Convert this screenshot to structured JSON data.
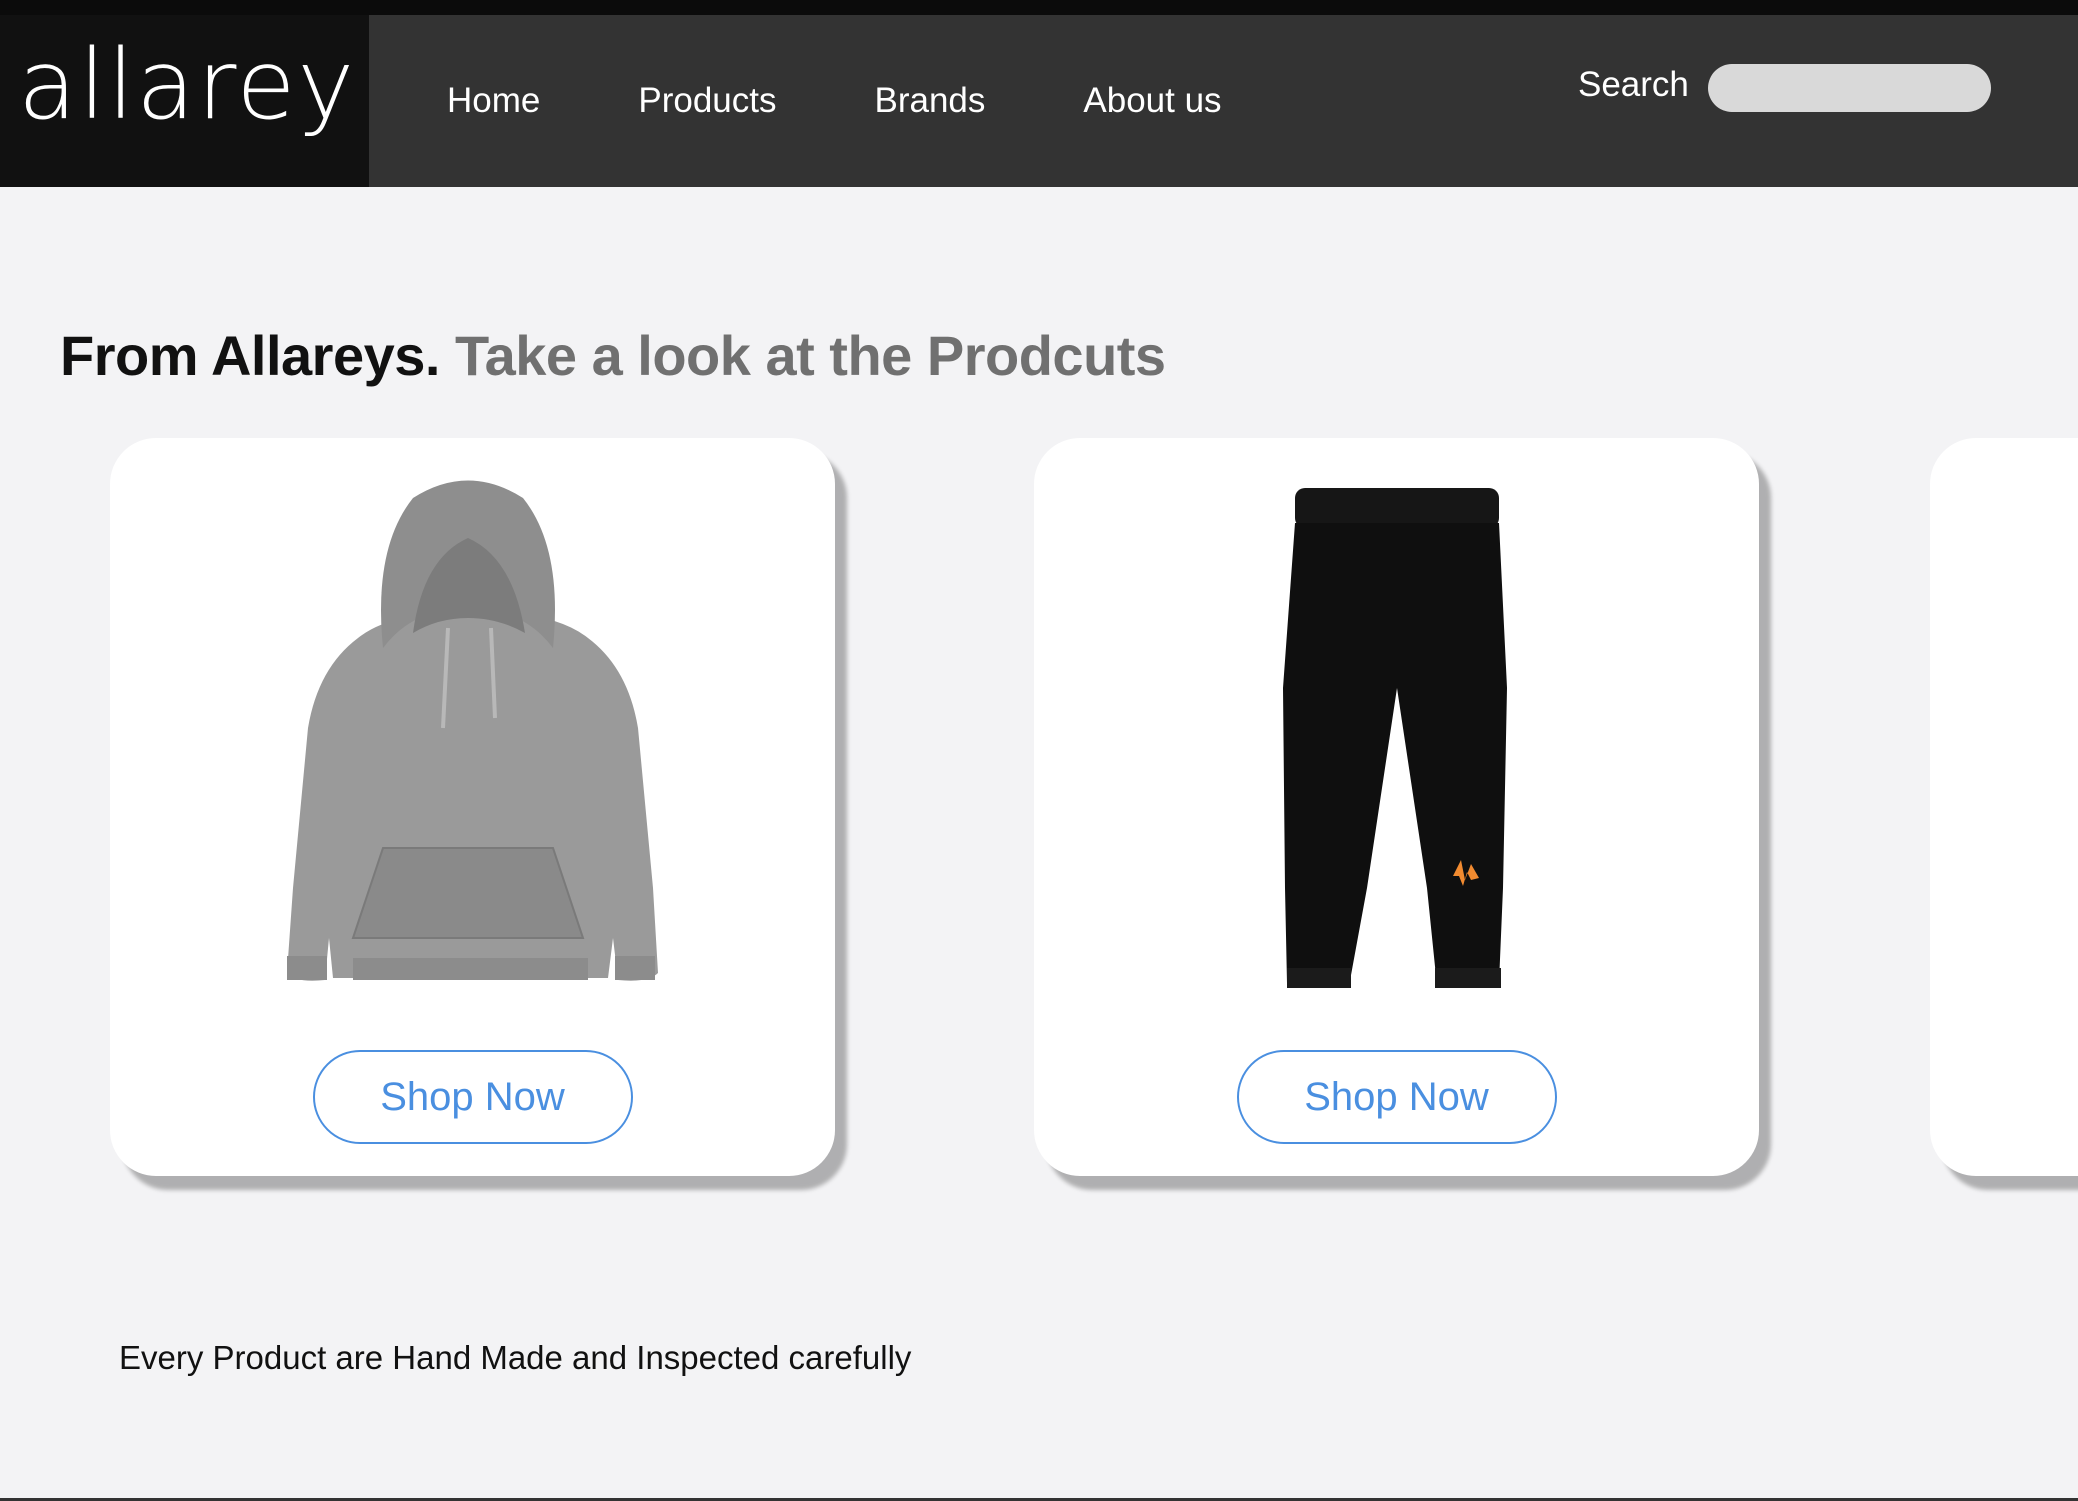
{
  "brand": {
    "logo_text": "allarey"
  },
  "nav": {
    "items": [
      "Home",
      "Products",
      "Brands",
      "About us"
    ],
    "search_label": "Search",
    "search_placeholder": ""
  },
  "hero": {
    "title_strong": "From Allareys.",
    "title_soft": "Take a look at the Prodcuts"
  },
  "products": [
    {
      "image": "grey-hoodie",
      "button_label": "Shop Now"
    },
    {
      "image": "black-joggers",
      "button_label": "Shop Now"
    }
  ],
  "footnote": "Every Product are Hand Made and Inspected carefully",
  "colors": {
    "nav_bg": "#333333",
    "logo_bg": "#111111",
    "accent": "#4a8fe0",
    "page_bg": "#f3f3f5",
    "heading_soft": "#707070"
  }
}
